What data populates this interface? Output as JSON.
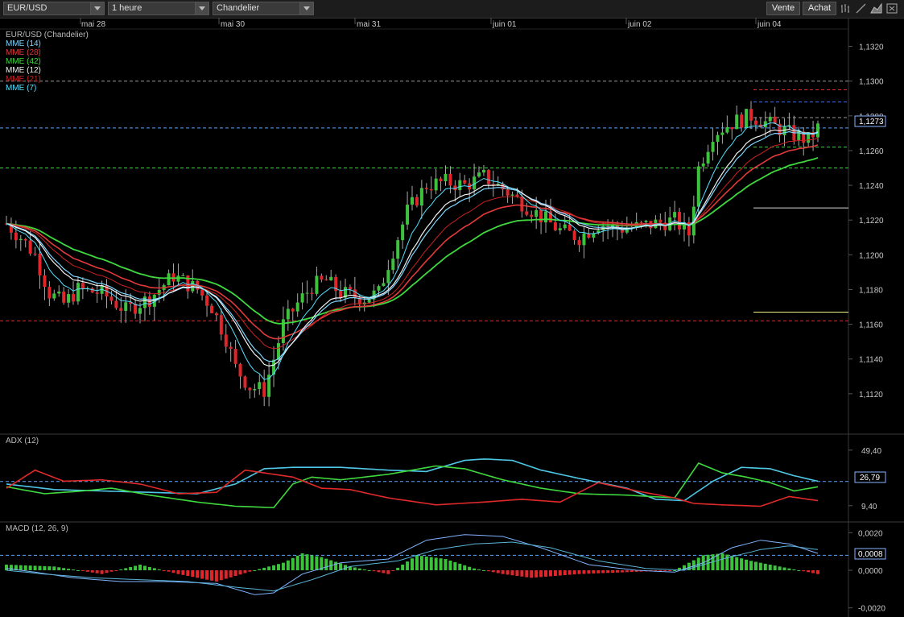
{
  "toolbar": {
    "symbol": "EUR/USD",
    "interval": "1 heure",
    "chart_type": "Chandelier",
    "sell_label": "Vente",
    "buy_label": "Achat",
    "tool_icons": [
      "bar-chart-icon",
      "line-chart-icon",
      "area-chart-icon",
      "expand-icon"
    ]
  },
  "colors": {
    "background": "#000000",
    "up_candle": "#3ec23e",
    "down_candle": "#e0262a",
    "grid": "#2a2a2a",
    "axis_text": "#c8c8c8",
    "mme14": "#7fd6ff",
    "mme28": "#e23a3a",
    "mme42": "#3fd83f",
    "mme12": "#f2f2f2",
    "mme21": "#cc2222",
    "mme7": "#55e0ff",
    "adx": "#4fc8e8",
    "di_plus": "#3fd83f",
    "di_minus": "#e02a2a",
    "macd_line": "#7fb4ff",
    "signal_line": "#5ab4d8"
  },
  "chart_data": [
    {
      "type": "candlestick",
      "title": "EUR/USD (Chandelier)",
      "x_tick_labels": [
        "mai 28",
        "mai 30",
        "mai 31",
        "juin 01",
        "juin 02",
        "juin 04"
      ],
      "ylim": [
        1.11,
        1.133
      ],
      "y_ticks": [
        "1,1320",
        "1,1300",
        "1,1280",
        "1,1260",
        "1,1240",
        "1,1220",
        "1,1200",
        "1,1180",
        "1,1160",
        "1,1140",
        "1,1120"
      ],
      "y_tick_values": [
        1.132,
        1.13,
        1.128,
        1.126,
        1.124,
        1.122,
        1.12,
        1.118,
        1.116,
        1.114,
        1.112
      ],
      "last_price_label": "1,1273",
      "last_price": 1.1273,
      "legend": [
        {
          "name": "MME (14)",
          "color_key": "mme14"
        },
        {
          "name": "MME (28)",
          "color_key": "mme28"
        },
        {
          "name": "MME (42)",
          "color_key": "mme42"
        },
        {
          "name": "MME (12)",
          "color_key": "mme12"
        },
        {
          "name": "MME (21)",
          "color_key": "mme21"
        },
        {
          "name": "MME (7)",
          "color_key": "mme7"
        }
      ],
      "close_path": [
        [
          0,
          1.1218
        ],
        [
          3,
          1.121
        ],
        [
          6,
          1.12
        ],
        [
          9,
          1.1178
        ],
        [
          12,
          1.1172
        ],
        [
          15,
          1.118
        ],
        [
          20,
          1.1178
        ],
        [
          25,
          1.1168
        ],
        [
          30,
          1.1175
        ],
        [
          35,
          1.1188
        ],
        [
          40,
          1.118
        ],
        [
          43,
          1.117
        ],
        [
          46,
          1.1152
        ],
        [
          48,
          1.1135
        ],
        [
          51,
          1.1124
        ],
        [
          54,
          1.1122
        ],
        [
          56,
          1.114
        ],
        [
          58,
          1.116
        ],
        [
          61,
          1.1172
        ],
        [
          64,
          1.1182
        ],
        [
          67,
          1.1185
        ],
        [
          70,
          1.1178
        ],
        [
          75,
          1.1175
        ],
        [
          78,
          1.1178
        ],
        [
          80,
          1.1195
        ],
        [
          84,
          1.1225
        ],
        [
          88,
          1.124
        ],
        [
          92,
          1.1242
        ],
        [
          96,
          1.124
        ],
        [
          100,
          1.1245
        ],
        [
          104,
          1.1238
        ],
        [
          108,
          1.123
        ],
        [
          112,
          1.1222
        ],
        [
          116,
          1.1214
        ],
        [
          120,
          1.121
        ],
        [
          124,
          1.1218
        ],
        [
          128,
          1.1215
        ],
        [
          132,
          1.1216
        ],
        [
          136,
          1.1218
        ],
        [
          140,
          1.122
        ],
        [
          143,
          1.1212
        ],
        [
          145,
          1.125
        ],
        [
          148,
          1.127
        ],
        [
          152,
          1.1276
        ],
        [
          156,
          1.128
        ],
        [
          160,
          1.1275
        ],
        [
          164,
          1.127
        ],
        [
          168,
          1.1266
        ],
        [
          170,
          1.1273
        ]
      ],
      "candle_count": 171,
      "horizontal_levels": [
        {
          "value": 1.13,
          "color": "#9a9a9a",
          "style": "dashed"
        },
        {
          "value": 1.1273,
          "color": "#5aa8ff",
          "style": "dashed"
        },
        {
          "value": 1.125,
          "color": "#3fd83f",
          "style": "dashed"
        },
        {
          "value": 1.1162,
          "color": "#e02a2a",
          "style": "dashed"
        }
      ],
      "short_levels": [
        {
          "value": 1.1295,
          "color": "#e02a2a"
        },
        {
          "value": 1.1288,
          "color": "#3a6fff"
        },
        {
          "value": 1.1279,
          "color": "#9a9a9a"
        },
        {
          "value": 1.1262,
          "color": "#3fd83f"
        },
        {
          "value": 1.1227,
          "color": "#d8d8d8"
        },
        {
          "value": 1.1167,
          "color": "#f0f080"
        }
      ]
    },
    {
      "type": "line",
      "title": "ADX (12)",
      "ylim": [
        0,
        58
      ],
      "y_ticks": [
        "49,40",
        "9,40"
      ],
      "y_tick_values": [
        49.4,
        9.4
      ],
      "current_label": "26,79",
      "current_value": 26.79,
      "series": [
        {
          "name": "ADX",
          "color_key": "adx",
          "points": [
            [
              0,
              25
            ],
            [
              10,
              21
            ],
            [
              20,
              20
            ],
            [
              30,
              19
            ],
            [
              40,
              18
            ],
            [
              48,
              25
            ],
            [
              54,
              36
            ],
            [
              60,
              37
            ],
            [
              70,
              37
            ],
            [
              80,
              35
            ],
            [
              88,
              34
            ],
            [
              96,
              42
            ],
            [
              100,
              43
            ],
            [
              106,
              42
            ],
            [
              112,
              35
            ],
            [
              120,
              29
            ],
            [
              130,
              22
            ],
            [
              136,
              14
            ],
            [
              142,
              13
            ],
            [
              148,
              27
            ],
            [
              154,
              37
            ],
            [
              160,
              36
            ],
            [
              165,
              31
            ],
            [
              170,
              27
            ]
          ]
        },
        {
          "name": "DI+",
          "color_key": "di_plus",
          "points": [
            [
              0,
              23
            ],
            [
              8,
              18
            ],
            [
              16,
              20
            ],
            [
              22,
              22
            ],
            [
              30,
              17
            ],
            [
              40,
              12
            ],
            [
              48,
              9
            ],
            [
              56,
              8
            ],
            [
              60,
              25
            ],
            [
              64,
              30
            ],
            [
              70,
              28
            ],
            [
              80,
              32
            ],
            [
              90,
              38
            ],
            [
              96,
              36
            ],
            [
              104,
              28
            ],
            [
              112,
              22
            ],
            [
              120,
              18
            ],
            [
              130,
              17
            ],
            [
              140,
              15
            ],
            [
              145,
              40
            ],
            [
              150,
              33
            ],
            [
              155,
              30
            ],
            [
              160,
              26
            ],
            [
              165,
              20
            ],
            [
              170,
              23
            ]
          ]
        },
        {
          "name": "DI-",
          "color_key": "di_minus",
          "points": [
            [
              0,
              22
            ],
            [
              6,
              35
            ],
            [
              12,
              27
            ],
            [
              20,
              28
            ],
            [
              28,
              25
            ],
            [
              36,
              18
            ],
            [
              44,
              19
            ],
            [
              50,
              35
            ],
            [
              54,
              33
            ],
            [
              60,
              30
            ],
            [
              66,
              22
            ],
            [
              72,
              21
            ],
            [
              80,
              15
            ],
            [
              90,
              10
            ],
            [
              100,
              12
            ],
            [
              108,
              14
            ],
            [
              116,
              12
            ],
            [
              124,
              26
            ],
            [
              132,
              20
            ],
            [
              140,
              15
            ],
            [
              144,
              11
            ],
            [
              150,
              10
            ],
            [
              158,
              9
            ],
            [
              164,
              16
            ],
            [
              170,
              13
            ]
          ]
        }
      ]
    },
    {
      "type": "bar",
      "title": "MACD (12, 26, 9)",
      "ylim": [
        -0.0024,
        0.0024
      ],
      "y_ticks": [
        "0,0020",
        "0,0000",
        "-0,0020"
      ],
      "y_tick_values": [
        0.002,
        0.0,
        -0.002
      ],
      "current_label": "0,0008",
      "current_value": 0.0008,
      "histogram_path": [
        [
          0,
          0.0003
        ],
        [
          10,
          0.0002
        ],
        [
          20,
          -0.0002
        ],
        [
          28,
          0.0003
        ],
        [
          36,
          -0.0002
        ],
        [
          44,
          -0.0006
        ],
        [
          52,
          0.0
        ],
        [
          58,
          0.0004
        ],
        [
          62,
          0.0009
        ],
        [
          66,
          0.0007
        ],
        [
          72,
          0.0002
        ],
        [
          80,
          -0.0002
        ],
        [
          86,
          0.0008
        ],
        [
          92,
          0.0006
        ],
        [
          98,
          0.0001
        ],
        [
          104,
          -0.0002
        ],
        [
          110,
          -0.0004
        ],
        [
          120,
          -0.0002
        ],
        [
          140,
          0.0
        ],
        [
          146,
          0.0008
        ],
        [
          150,
          0.0009
        ],
        [
          156,
          0.0005
        ],
        [
          162,
          0.0002
        ],
        [
          170,
          -0.0002
        ]
      ],
      "series": [
        {
          "name": "MACD",
          "color_key": "macd_line",
          "points": [
            [
              0,
              0.0001
            ],
            [
              6,
              -0.0001
            ],
            [
              14,
              -0.0004
            ],
            [
              24,
              -0.0006
            ],
            [
              34,
              -0.0006
            ],
            [
              44,
              -0.0007
            ],
            [
              52,
              -0.0013
            ],
            [
              56,
              -0.0012
            ],
            [
              62,
              -0.0002
            ],
            [
              70,
              0.0004
            ],
            [
              80,
              0.0006
            ],
            [
              88,
              0.0016
            ],
            [
              96,
              0.0019
            ],
            [
              104,
              0.0018
            ],
            [
              112,
              0.0012
            ],
            [
              122,
              0.0003
            ],
            [
              132,
              0.0
            ],
            [
              140,
              -0.0001
            ],
            [
              146,
              0.0004
            ],
            [
              152,
              0.0012
            ],
            [
              158,
              0.0016
            ],
            [
              164,
              0.0014
            ],
            [
              170,
              0.0009
            ]
          ]
        },
        {
          "name": "Signal",
          "color_key": "signal_line",
          "points": [
            [
              0,
              0.0
            ],
            [
              8,
              -0.0002
            ],
            [
              18,
              -0.0004
            ],
            [
              28,
              -0.0005
            ],
            [
              38,
              -0.0006
            ],
            [
              48,
              -0.0009
            ],
            [
              56,
              -0.0011
            ],
            [
              64,
              -0.0005
            ],
            [
              72,
              0.0002
            ],
            [
              82,
              0.0005
            ],
            [
              90,
              0.0011
            ],
            [
              98,
              0.0014
            ],
            [
              106,
              0.0015
            ],
            [
              114,
              0.0012
            ],
            [
              124,
              0.0005
            ],
            [
              134,
              0.0001
            ],
            [
              142,
              0.0
            ],
            [
              150,
              0.0006
            ],
            [
              158,
              0.0011
            ],
            [
              164,
              0.0013
            ],
            [
              170,
              0.0011
            ]
          ]
        }
      ]
    }
  ]
}
